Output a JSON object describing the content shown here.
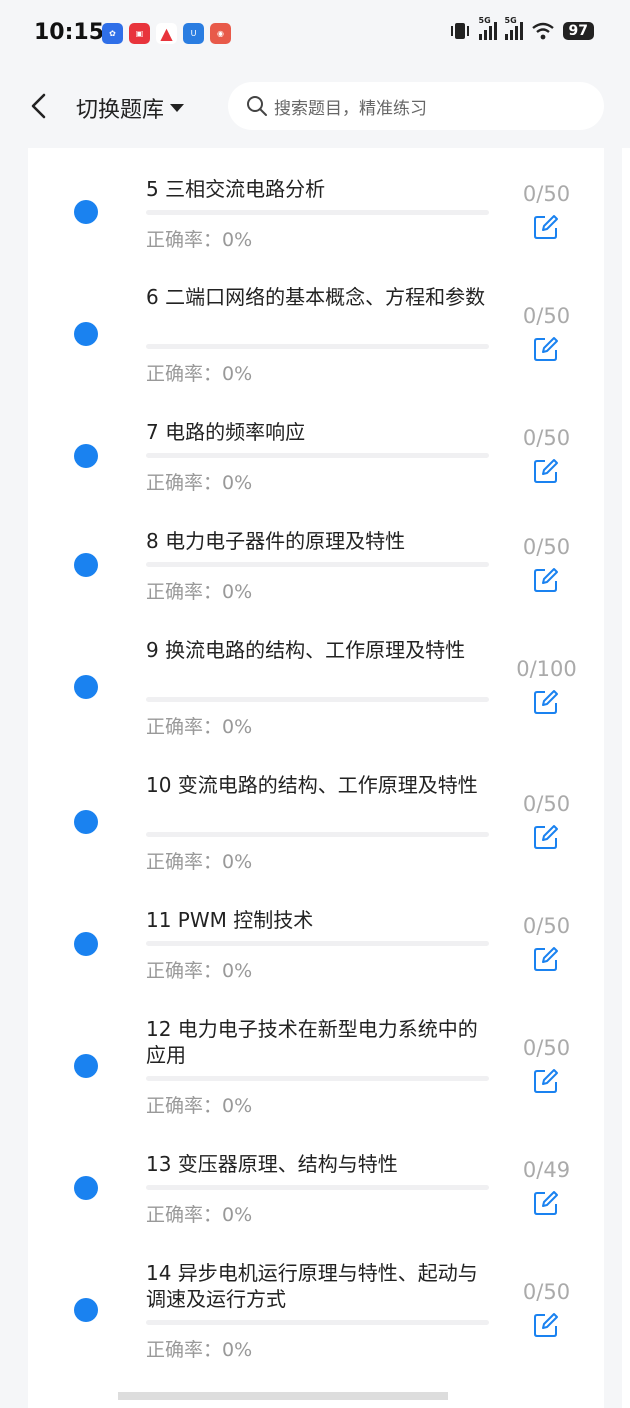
{
  "status": {
    "time": "10:15",
    "battery": "97",
    "sig1": "5G",
    "sig2": "5G"
  },
  "header": {
    "title": "切换题库",
    "search_placeholder": "搜索题目，精准练习"
  },
  "items": [
    {
      "name": "5 三相交流电路分析",
      "rate": "正确率：0%",
      "count": "0/50"
    },
    {
      "name": "6 二端口网络的基本概念、方程和参数",
      "rate": "正确率：0%",
      "count": "0/50"
    },
    {
      "name": "7 电路的频率响应",
      "rate": "正确率：0%",
      "count": "0/50"
    },
    {
      "name": "8 电力电子器件的原理及特性",
      "rate": "正确率：0%",
      "count": "0/50"
    },
    {
      "name": "9 换流电路的结构、工作原理及特性",
      "rate": "正确率：0%",
      "count": "0/100"
    },
    {
      "name": "10 变流电路的结构、工作原理及特性",
      "rate": "正确率：0%",
      "count": "0/50"
    },
    {
      "name": "11 PWM 控制技术",
      "rate": "正确率：0%",
      "count": "0/50"
    },
    {
      "name": "12 电力电子技术在新型电力系统中的应用",
      "rate": "正确率：0%",
      "count": "0/50"
    },
    {
      "name": "13 变压器原理、结构与特性",
      "rate": "正确率：0%",
      "count": "0/49"
    },
    {
      "name": "14 异步电机运行原理与特性、起动与调速及运行方式",
      "rate": "正确率：0%",
      "count": "0/50"
    }
  ],
  "colors": {
    "accent": "#1a82f0",
    "muted": "#999999"
  }
}
